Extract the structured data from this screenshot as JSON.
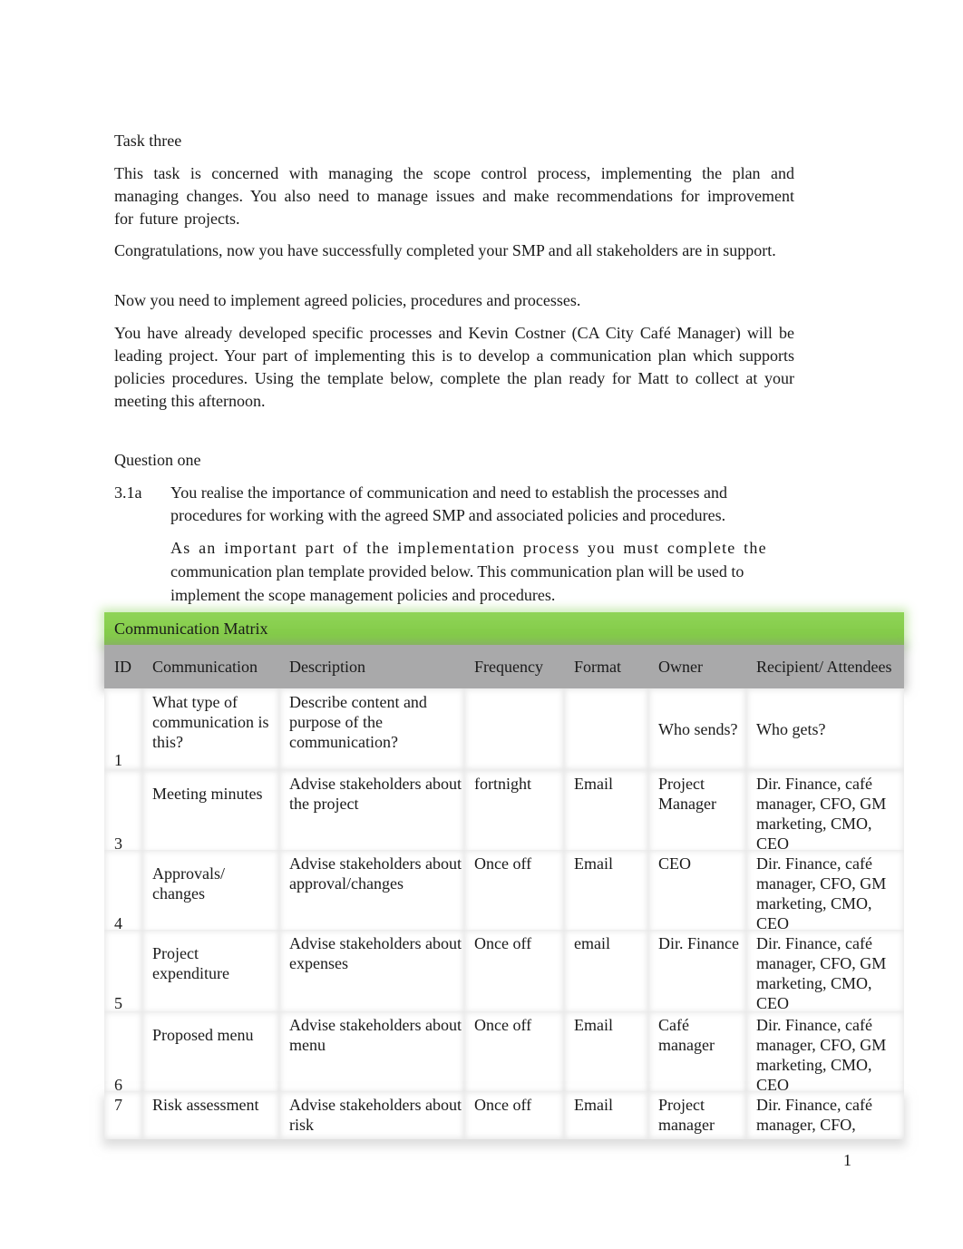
{
  "task": {
    "heading": "Task three",
    "intro": "This task is concerned with managing the scope control process, implementing the plan and managing changes. You also need to manage issues and make recommendations for improvement for future projects.",
    "congrats": "Congratulations, now you have successfully completed your SMP and all stakeholders are in support.",
    "now": "Now you need to implement agreed policies, procedures and processes.",
    "already": "You have already developed specific processes and Kevin Costner (CA City Café Manager) will be leading project. Your part of implementing this is to develop a communication plan which supports policies procedures. Using the template below, complete the plan ready for Matt to collect at your meeting this afternoon."
  },
  "question": {
    "heading": "Question one",
    "number": "3.1a",
    "para1": "You realise the importance of communication and need to establish the processes and procedures for working with the agreed SMP and associated policies and procedures.",
    "para2_line1": "As an important part of the implementation process you must complete the",
    "para2_rest": "communication plan template provided below. This communication plan will be used to implement the scope management policies and procedures."
  },
  "matrix": {
    "title": "Communication Matrix",
    "title_color": "#7fc843",
    "header_color": "#a9a9aa",
    "columns": [
      "ID",
      "Communication",
      "Description",
      "Frequency",
      "Format",
      "Owner",
      "Recipient/ Attendees"
    ],
    "rows": [
      {
        "id": "1",
        "communication": "What type of communication is this?",
        "description": "Describe content and purpose of the communication?",
        "frequency": "",
        "format": "",
        "owner": "Who sends?",
        "recipient": "Who gets?"
      },
      {
        "id": "3",
        "communication": "Meeting minutes",
        "description": "Advise stakeholders about the project",
        "frequency": "fortnight",
        "format": "Email",
        "owner": "Project Manager",
        "recipient": "Dir. Finance, café manager, CFO, GM marketing, CMO, CEO"
      },
      {
        "id": "4",
        "communication": "Approvals/ changes",
        "description": "Advise stakeholders about approval/changes",
        "frequency": "Once off",
        "format": "Email",
        "owner": "CEO",
        "recipient": "Dir. Finance, café manager, CFO, GM marketing, CMO, CEO"
      },
      {
        "id": "5",
        "communication": "Project expenditure",
        "description": "Advise stakeholders about expenses",
        "frequency": "Once off",
        "format": "email",
        "owner": "Dir. Finance",
        "recipient": "Dir. Finance, café manager, CFO, GM marketing, CMO, CEO"
      },
      {
        "id": "6",
        "communication": "Proposed menu",
        "description": "Advise stakeholders about menu",
        "frequency": "Once off",
        "format": "Email",
        "owner": "Café manager",
        "recipient": "Dir. Finance, café manager, CFO, GM marketing, CMO, CEO"
      },
      {
        "id": "7",
        "communication": "Risk assessment",
        "description": "Advise stakeholders about risk",
        "frequency": "Once off",
        "format": "Email",
        "owner": "Project manager",
        "recipient": "Dir. Finance, café manager, CFO,"
      }
    ]
  },
  "footer": {
    "page_number": "1"
  }
}
